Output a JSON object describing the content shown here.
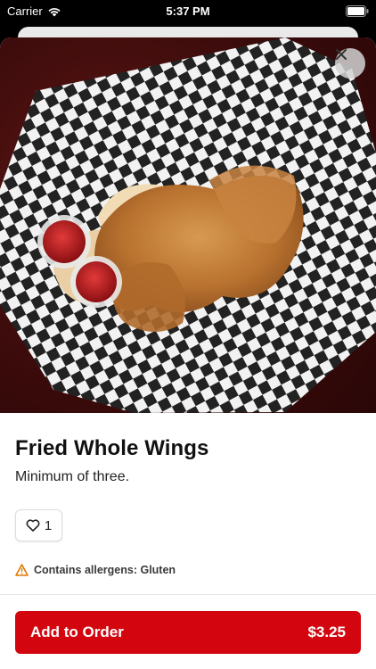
{
  "status_bar": {
    "carrier": "Carrier",
    "time": "5:37 PM"
  },
  "item": {
    "image_icon": "fried-chicken-wings-photo",
    "name": "Fried Whole Wings",
    "description": "Minimum of three.",
    "like_count": "1",
    "allergen_text": "Contains allergens: Gluten"
  },
  "order_button": {
    "label": "Add to Order",
    "price": "$3.25"
  },
  "colors": {
    "accent": "#d3060f",
    "warning": "#e07a00"
  }
}
